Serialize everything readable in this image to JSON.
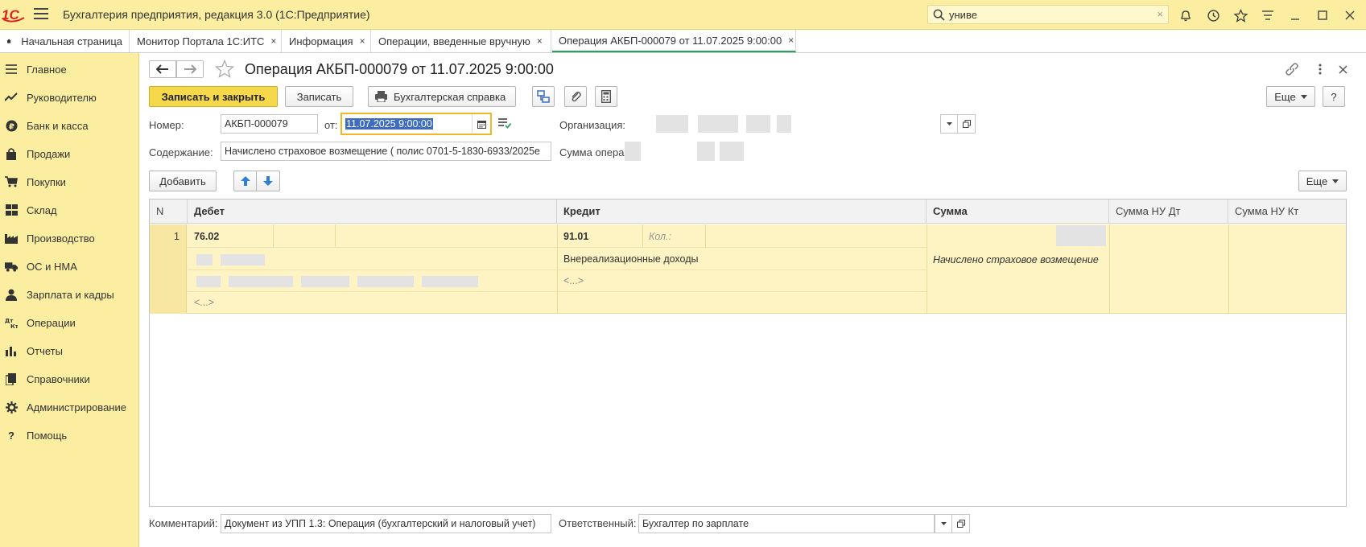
{
  "titlebar": {
    "app_title": "Бухгалтерия предприятия, редакция 3.0  (1С:Предприятие)",
    "search_value": "униве",
    "clear_symbol": "×"
  },
  "tabs": [
    {
      "label": "Начальная страница"
    },
    {
      "label": "Монитор Портала 1С:ИТС"
    },
    {
      "label": "Информация"
    },
    {
      "label": "Операции, введенные вручную"
    },
    {
      "label": "Операция АКБП-000079 от 11.07.2025 9:00:00"
    }
  ],
  "tab_close": "×",
  "sidebar": {
    "items": [
      {
        "label": "Главное",
        "icon": "menu-lines-icon"
      },
      {
        "label": "Руководителю",
        "icon": "trend-icon"
      },
      {
        "label": "Банк и касса",
        "icon": "ruble-coin-icon"
      },
      {
        "label": "Продажи",
        "icon": "shopping-bag-icon"
      },
      {
        "label": "Покупки",
        "icon": "cart-icon"
      },
      {
        "label": "Склад",
        "icon": "warehouse-grid-icon"
      },
      {
        "label": "Производство",
        "icon": "factory-icon"
      },
      {
        "label": "ОС и НМА",
        "icon": "truck-icon"
      },
      {
        "label": "Зарплата и кадры",
        "icon": "person-icon"
      },
      {
        "label": "Операции",
        "icon": "debit-credit-icon"
      },
      {
        "label": "Отчеты",
        "icon": "bar-chart-icon"
      },
      {
        "label": "Справочники",
        "icon": "books-icon"
      },
      {
        "label": "Администрирование",
        "icon": "gear-icon"
      },
      {
        "label": "Помощь",
        "icon": "question-icon"
      }
    ]
  },
  "form": {
    "title": "Операция АКБП-000079 от 11.07.2025 9:00:00",
    "buttons": {
      "save_close": "Записать и закрыть",
      "save": "Записать",
      "print": "Бухгалтерская справка",
      "more": "Еще",
      "help": "?",
      "add": "Добавить"
    },
    "fields": {
      "number_label": "Номер:",
      "number_value": "АКБП-000079",
      "date_label": "от:",
      "date_value": "11.07.2025  9:00:00",
      "org_label": "Организация:",
      "content_label": "Содержание:",
      "content_value": "Начислено страховое возмещение ( полис 0701-5-1830-6933/2025е",
      "sum_label": "Сумма опера"
    },
    "grid": {
      "columns": [
        "N",
        "Дебет",
        "Кредит",
        "Сумма",
        "Сумма НУ Дт",
        "Сумма НУ Кт"
      ],
      "rows": [
        {
          "n": "1",
          "debit_account": "76.02",
          "debit_more": "<...>",
          "credit_account": "91.01",
          "credit_qty_label": "Кол.:",
          "credit_subconto": "Внереализационные доходы",
          "credit_more": "<...>",
          "content": "Начислено страховое возмещение"
        }
      ]
    },
    "footer": {
      "comment_label": "Комментарий:",
      "comment_value": "Документ из УПП 1.3: Операция (бухгалтерский и налоговый учет)",
      "responsible_label": "Ответственный:",
      "responsible_value": "Бухгалтер по зарплате"
    }
  },
  "colors": {
    "accent_yellow": "#fbeea0",
    "primary_button": "#f6d94a",
    "active_tab_underline": "#2aa35a",
    "selection": "#3d6cc1",
    "focus_border": "#f3b723"
  }
}
